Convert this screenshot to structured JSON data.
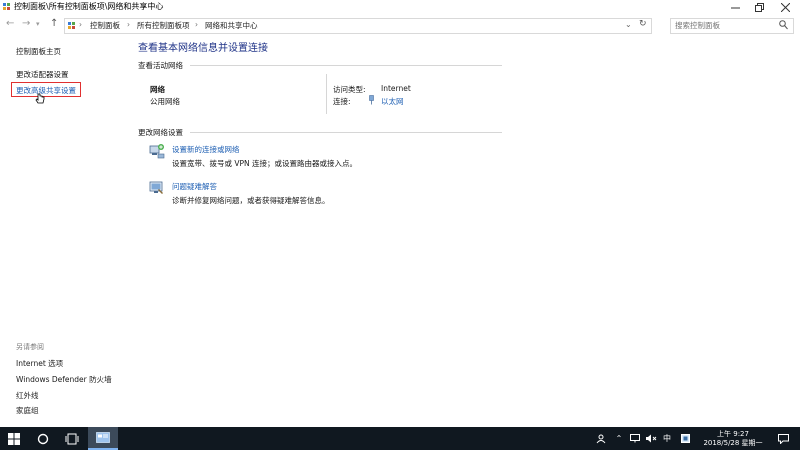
{
  "window": {
    "title": "控制面板\\所有控制面板项\\网络和共享中心"
  },
  "address": {
    "crumbs": [
      "控制面板",
      "所有控制面板项",
      "网络和共享中心"
    ],
    "search_placeholder": "搜索控制面板"
  },
  "sidebar": {
    "items": [
      "控制面板主页",
      "更改适配器设置",
      "更改高级共享设置"
    ],
    "see_also_title": "另请参阅",
    "see_also": [
      "Internet 选项",
      "Windows Defender 防火墙",
      "红外线",
      "家庭组"
    ]
  },
  "main": {
    "heading": "查看基本网络信息并设置连接",
    "active_section": "查看活动网络",
    "network_name": "网络",
    "network_type": "公用网络",
    "access_type_label": "访问类型:",
    "access_type_value": "Internet",
    "connections_label": "连接:",
    "connection_value": "以太网",
    "change_section": "更改网络设置",
    "tasks": [
      {
        "title": "设置新的连接或网络",
        "desc": "设置宽带、拨号或 VPN 连接；或设置路由器或接入点。"
      },
      {
        "title": "问题疑难解答",
        "desc": "诊断并修复网络问题，或者获得疑难解答信息。"
      }
    ]
  },
  "taskbar": {
    "time": "上午 9:27",
    "date": "2018/5/28 星期一",
    "ime": "中"
  },
  "colors": {
    "heading": "#1e3287",
    "link": "#1e5fb3",
    "taskbar": "#101820",
    "highlight_border": "#e03030"
  }
}
